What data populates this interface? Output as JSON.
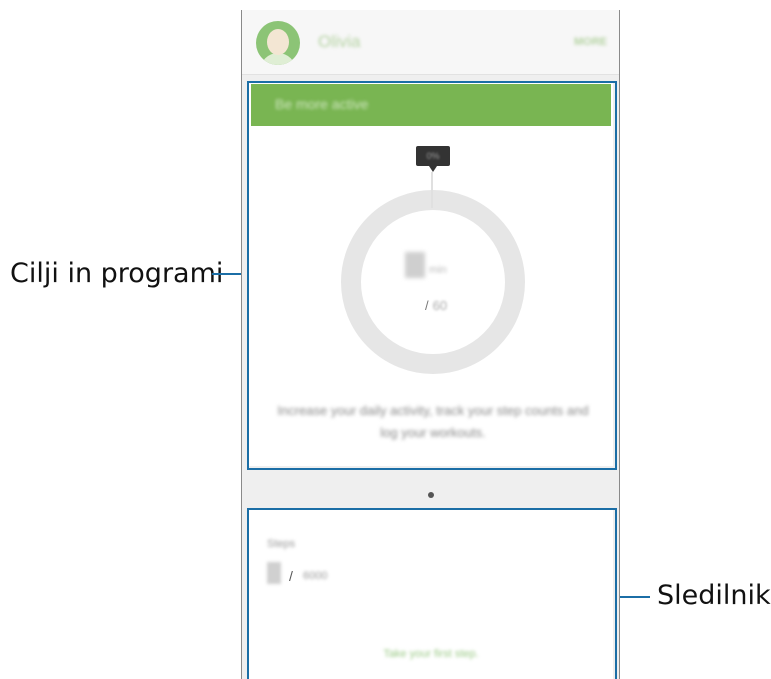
{
  "callouts": {
    "goals": "Cilji in programi",
    "trackers": "Sledilniki"
  },
  "profile": {
    "name": "Olivia",
    "more_label": "MORE"
  },
  "goal_card": {
    "title": "Be more active",
    "badge": "0%",
    "value": "0",
    "unit": "min",
    "goal_separator": "/",
    "goal_value": "60",
    "description": "Increase your daily activity, track your step counts and log your workouts."
  },
  "steps_card": {
    "label": "Steps",
    "value": "0",
    "separator": "/",
    "goal": "6000",
    "message": "Take your first step."
  },
  "colors": {
    "accent_green": "#79b552",
    "callout_blue": "#1b6ea6"
  }
}
